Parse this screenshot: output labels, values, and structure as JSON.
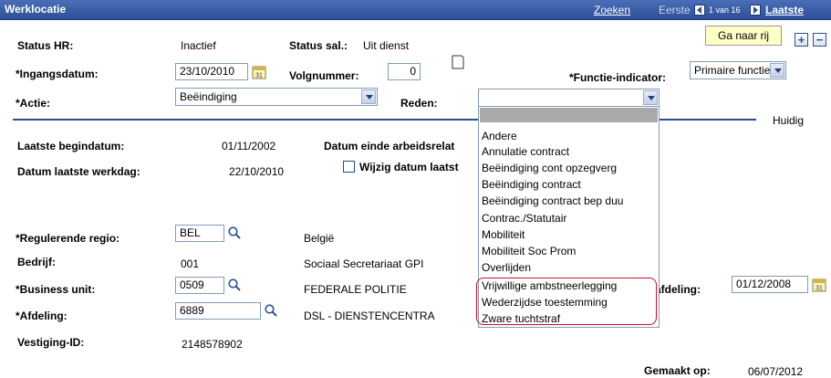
{
  "header": {
    "title": "Werklocatie",
    "search_link": "Zoeken",
    "first_label": "Eerste",
    "position_text": "1 van 16",
    "last_link": "Laatste"
  },
  "fields": {
    "status_hr_label": "Status HR:",
    "status_hr_value": "Inactief",
    "status_sal_label": "Status sal.:",
    "status_sal_value": "Uit dienst",
    "go_to_row_button": "Ga naar rij",
    "ingangsdatum_label": "*Ingangsdatum:",
    "ingangsdatum_value": "23/10/2010",
    "volgnummer_label": "Volgnummer:",
    "volgnummer_value": "0",
    "functie_indicator_label": "*Functie-indicator:",
    "functie_indicator_value": "Primaire functie",
    "actie_label": "*Actie:",
    "actie_value": "Beëindiging",
    "reden_label": "Reden:",
    "reden_value": "",
    "huidig_label": "Huidig",
    "laatste_begindatum_label": "Laatste begindatum:",
    "laatste_begindatum_value": "01/11/2002",
    "datum_einde_label": "Datum einde arbeidsrelat",
    "datum_laatste_werkdag_label": "Datum laatste werkdag:",
    "datum_laatste_werkdag_value": "22/10/2010",
    "wijzig_datum_label": "Wijzig datum laatst",
    "regulerende_regio_label": "*Regulerende regio:",
    "regulerende_regio_value": "BEL",
    "regulerende_regio_desc": "België",
    "bedrijf_label": "Bedrijf:",
    "bedrijf_value": "001",
    "bedrijf_desc": "Sociaal Secretariaat GPI",
    "business_unit_label": "*Business unit:",
    "business_unit_value": "0509",
    "business_unit_desc": "FEDERALE POLITIE",
    "afdeling_date_label": "afdeling:",
    "afdeling_date_value": "01/12/2008",
    "afdeling_label": "*Afdeling:",
    "afdeling_value": "6889",
    "afdeling_desc": "DSL - DIENSTENCENTRA",
    "vestiging_label": "Vestiging-ID:",
    "vestiging_value": "2148578902",
    "gemaakt_op_label": "Gemaakt op:",
    "gemaakt_op_value": "06/07/2012"
  },
  "reden_options": [
    "Andere",
    "Annulatie contract",
    "Beëindiging cont opzegverg",
    "Beëindiging contract",
    "Beëindiging contract bep duu",
    "Contrac./Statutair",
    "Mobiliteit",
    "Mobiliteit Soc Prom",
    "Overlijden",
    "Vrijwillige ambstneerlegging",
    "Wederzijdse toestemming",
    "Zware tuchtstraf"
  ],
  "colors": {
    "header": "#2c4f96",
    "highlight_box": "#c8102e",
    "button_bg": "#ffffc8"
  }
}
